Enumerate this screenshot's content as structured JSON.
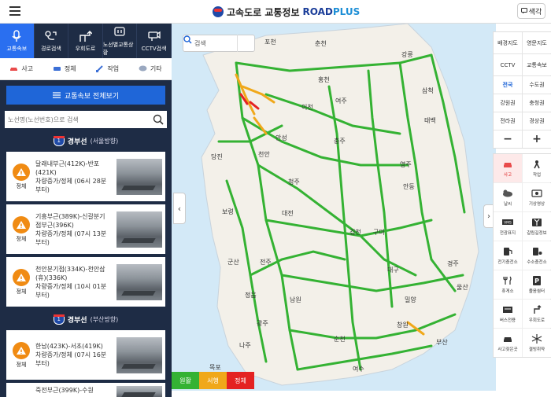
{
  "header": {
    "title_kr": "고속도로 교통정보",
    "title_road": "ROAD",
    "title_plus": "PLUS",
    "color_button": "색각"
  },
  "tabs": [
    {
      "label": "교통속보",
      "icon": "mic-icon",
      "active": true
    },
    {
      "label": "경로검색",
      "icon": "route-icon",
      "active": false
    },
    {
      "label": "우회도로",
      "icon": "detour-icon",
      "active": false
    },
    {
      "label": "노선별교통상황",
      "icon": "road-sign-icon",
      "active": false
    },
    {
      "label": "CCTV검색",
      "icon": "cctv-icon",
      "active": false
    }
  ],
  "subtabs": [
    {
      "label": "사고",
      "icon": "car-icon",
      "color": "#e94b4b"
    },
    {
      "label": "정체",
      "icon": "traffic-icon",
      "color": "#3b6fd6"
    },
    {
      "label": "작업",
      "icon": "work-icon",
      "color": "#3b6fd6"
    },
    {
      "label": "기타",
      "icon": "chat-icon",
      "color": "#3b6fd6"
    }
  ],
  "bulletin_button": "교통속보 전체보기",
  "search": {
    "placeholder": "노선명(노선번호)으로 검색"
  },
  "routes": [
    {
      "number": "1",
      "name": "경부선",
      "direction": "(서울방향)"
    },
    {
      "number": "1",
      "name": "경부선",
      "direction": "(부산방향)"
    }
  ],
  "cards": [
    {
      "status": "정체",
      "line1": "달래내부근(412K)-반포",
      "line2": "(421K)",
      "line3": "차량증가/정체 (06시 28분",
      "line4": "부터)"
    },
    {
      "status": "정체",
      "line1": "기흥부근(389K)-신갈분기",
      "line2": "점부근(396K)",
      "line3": "차량증가/정체 (07시 13분",
      "line4": "부터)"
    },
    {
      "status": "정체",
      "line1": "천안분기점(334K)-천안삼",
      "line2": "(휴)(336K)",
      "line3": "차량증가/정체 (10시 01분",
      "line4": "부터)"
    },
    {
      "status": "정체",
      "line1": "한남(423K)-서초(419K)",
      "line2": "차량증가/정체 (07시 16분",
      "line3": "부터)",
      "line4": ""
    },
    {
      "status": "정체",
      "line1": "죽전부근(399K)-수원",
      "line2": "",
      "line3": "",
      "line4": ""
    }
  ],
  "map": {
    "search_label": "검색",
    "cities": [
      {
        "name": "포천"
      },
      {
        "name": "춘천"
      },
      {
        "name": "강릉"
      },
      {
        "name": "홍천"
      },
      {
        "name": "삼척"
      },
      {
        "name": "이천"
      },
      {
        "name": "여주"
      },
      {
        "name": "태백"
      },
      {
        "name": "충주"
      },
      {
        "name": "당진"
      },
      {
        "name": "천안"
      },
      {
        "name": "안성"
      },
      {
        "name": "청주"
      },
      {
        "name": "영주"
      },
      {
        "name": "안동"
      },
      {
        "name": "보령"
      },
      {
        "name": "대전"
      },
      {
        "name": "김천"
      },
      {
        "name": "구미"
      },
      {
        "name": "군산"
      },
      {
        "name": "전주"
      },
      {
        "name": "대구"
      },
      {
        "name": "경주"
      },
      {
        "name": "울산"
      },
      {
        "name": "정읍"
      },
      {
        "name": "남원"
      },
      {
        "name": "밀양"
      },
      {
        "name": "광주"
      },
      {
        "name": "순천"
      },
      {
        "name": "창원"
      },
      {
        "name": "나주"
      },
      {
        "name": "목포"
      },
      {
        "name": "여수"
      },
      {
        "name": "부산"
      }
    ],
    "legend": [
      {
        "label": "원활",
        "color": "#34b233"
      },
      {
        "label": "서행",
        "color": "#f0a81a"
      },
      {
        "label": "정체",
        "color": "#e42222"
      }
    ]
  },
  "right_panel": {
    "map_types": [
      "배경지도",
      "영문지도",
      "CCTV",
      "교통속보"
    ],
    "regions": [
      "전국",
      "수도권",
      "강원권",
      "충청권",
      "전라권",
      "경상권"
    ],
    "active_region": "전국",
    "zoom_out": "−",
    "zoom_in": "+",
    "tools": [
      {
        "label": "사고",
        "icon": "accident-icon",
        "active": true
      },
      {
        "label": "작업",
        "icon": "worker-icon",
        "active": false
      },
      {
        "label": "날씨",
        "icon": "weather-icon",
        "active": false
      },
      {
        "label": "기상영상",
        "icon": "weather-video-icon",
        "active": false
      },
      {
        "label": "전광표지",
        "icon": "vms-icon",
        "active": false
      },
      {
        "label": "갈림길정보",
        "icon": "junction-icon",
        "active": false
      },
      {
        "label": "전기충전소",
        "icon": "ev-charger-icon",
        "active": false
      },
      {
        "label": "수소충전소",
        "icon": "hydrogen-station-icon",
        "active": false
      },
      {
        "label": "휴게소",
        "icon": "rest-area-icon",
        "active": false
      },
      {
        "label": "졸음쉼터",
        "icon": "parking-icon",
        "active": false
      },
      {
        "label": "버스전용",
        "icon": "bus-lane-icon",
        "active": false
      },
      {
        "label": "우회도로",
        "icon": "detour-icon",
        "active": false
      },
      {
        "label": "사고잦은곳",
        "icon": "accident-zone-icon",
        "active": false
      },
      {
        "label": "결빙취약",
        "icon": "ice-icon",
        "active": false
      }
    ]
  }
}
